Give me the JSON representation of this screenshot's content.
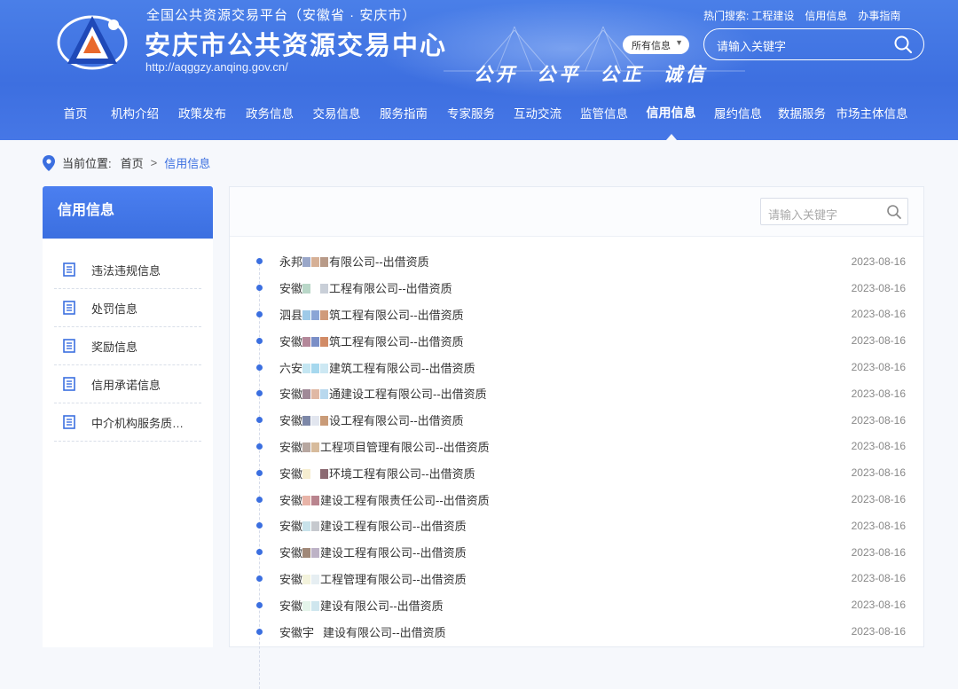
{
  "header": {
    "platform_title": "全国公共资源交易平台（安徽省 · 安庆市）",
    "center_title": "安庆市公共资源交易中心",
    "url": "http://aqggzy.anqing.gov.cn/",
    "slogan": "公开 公平 公正 诚信",
    "hot_search_label": "热门搜索:",
    "hot_search": [
      "工程建设",
      "信用信息",
      "办事指南"
    ],
    "scope_select": "所有信息",
    "search_placeholder": "请输入关键字"
  },
  "nav": [
    {
      "label": "首页"
    },
    {
      "label": "机构介绍"
    },
    {
      "label": "政策发布"
    },
    {
      "label": "政务信息"
    },
    {
      "label": "交易信息"
    },
    {
      "label": "服务指南"
    },
    {
      "label": "专家服务"
    },
    {
      "label": "互动交流"
    },
    {
      "label": "监管信息"
    },
    {
      "label": "信用信息",
      "active": true
    },
    {
      "label": "履约信息"
    },
    {
      "label": "数据服务"
    },
    {
      "label": "市场主体信息"
    }
  ],
  "breadcrumb": {
    "label": "当前位置:",
    "home": "首页",
    "separator": ">",
    "current": "信用信息"
  },
  "sidebar": {
    "title": "信用信息",
    "items": [
      "违法违规信息",
      "处罚信息",
      "奖励信息",
      "信用承诺信息",
      "中介机构服务质…"
    ]
  },
  "list_search_placeholder": "请输入关键字",
  "colors": {
    "header_blue": "#3d6fe0",
    "accent": "#3b6fe0",
    "date_gray": "#888888"
  },
  "rows": [
    {
      "prefix": "永邦",
      "suffix": "有限公司--出借资质",
      "date": "2023-08-16"
    },
    {
      "prefix": "安徽",
      "suffix": "工程有限公司--出借资质",
      "date": "2023-08-16"
    },
    {
      "prefix": "泗县",
      "suffix": "筑工程有限公司--出借资质",
      "date": "2023-08-16"
    },
    {
      "prefix": "安徽",
      "suffix": "筑工程有限公司--出借资质",
      "date": "2023-08-16"
    },
    {
      "prefix": "六安",
      "suffix": "建筑工程有限公司--出借资质",
      "date": "2023-08-16"
    },
    {
      "prefix": "安徽",
      "suffix": "通建设工程有限公司--出借资质",
      "date": "2023-08-16"
    },
    {
      "prefix": "安徽",
      "suffix": "设工程有限公司--出借资质",
      "date": "2023-08-16"
    },
    {
      "prefix": "安徽",
      "suffix": "工程项目管理有限公司--出借资质",
      "date": "2023-08-16"
    },
    {
      "prefix": "安徽",
      "suffix": "环境工程有限公司--出借资质",
      "date": "2023-08-16"
    },
    {
      "prefix": "安徽",
      "suffix": "建设工程有限责任公司--出借资质",
      "date": "2023-08-16"
    },
    {
      "prefix": "安徽",
      "suffix": "建设工程有限公司--出借资质",
      "date": "2023-08-16"
    },
    {
      "prefix": "安徽",
      "suffix": "建设工程有限公司--出借资质",
      "date": "2023-08-16"
    },
    {
      "prefix": "安徽",
      "suffix": "工程管理有限公司--出借资质",
      "date": "2023-08-16"
    },
    {
      "prefix": "安徽",
      "suffix": "建设有限公司--出借资质",
      "date": "2023-08-16"
    },
    {
      "prefix": "安徽宇",
      "suffix": "建设有限公司--出借资质",
      "date": "2023-08-16"
    }
  ]
}
